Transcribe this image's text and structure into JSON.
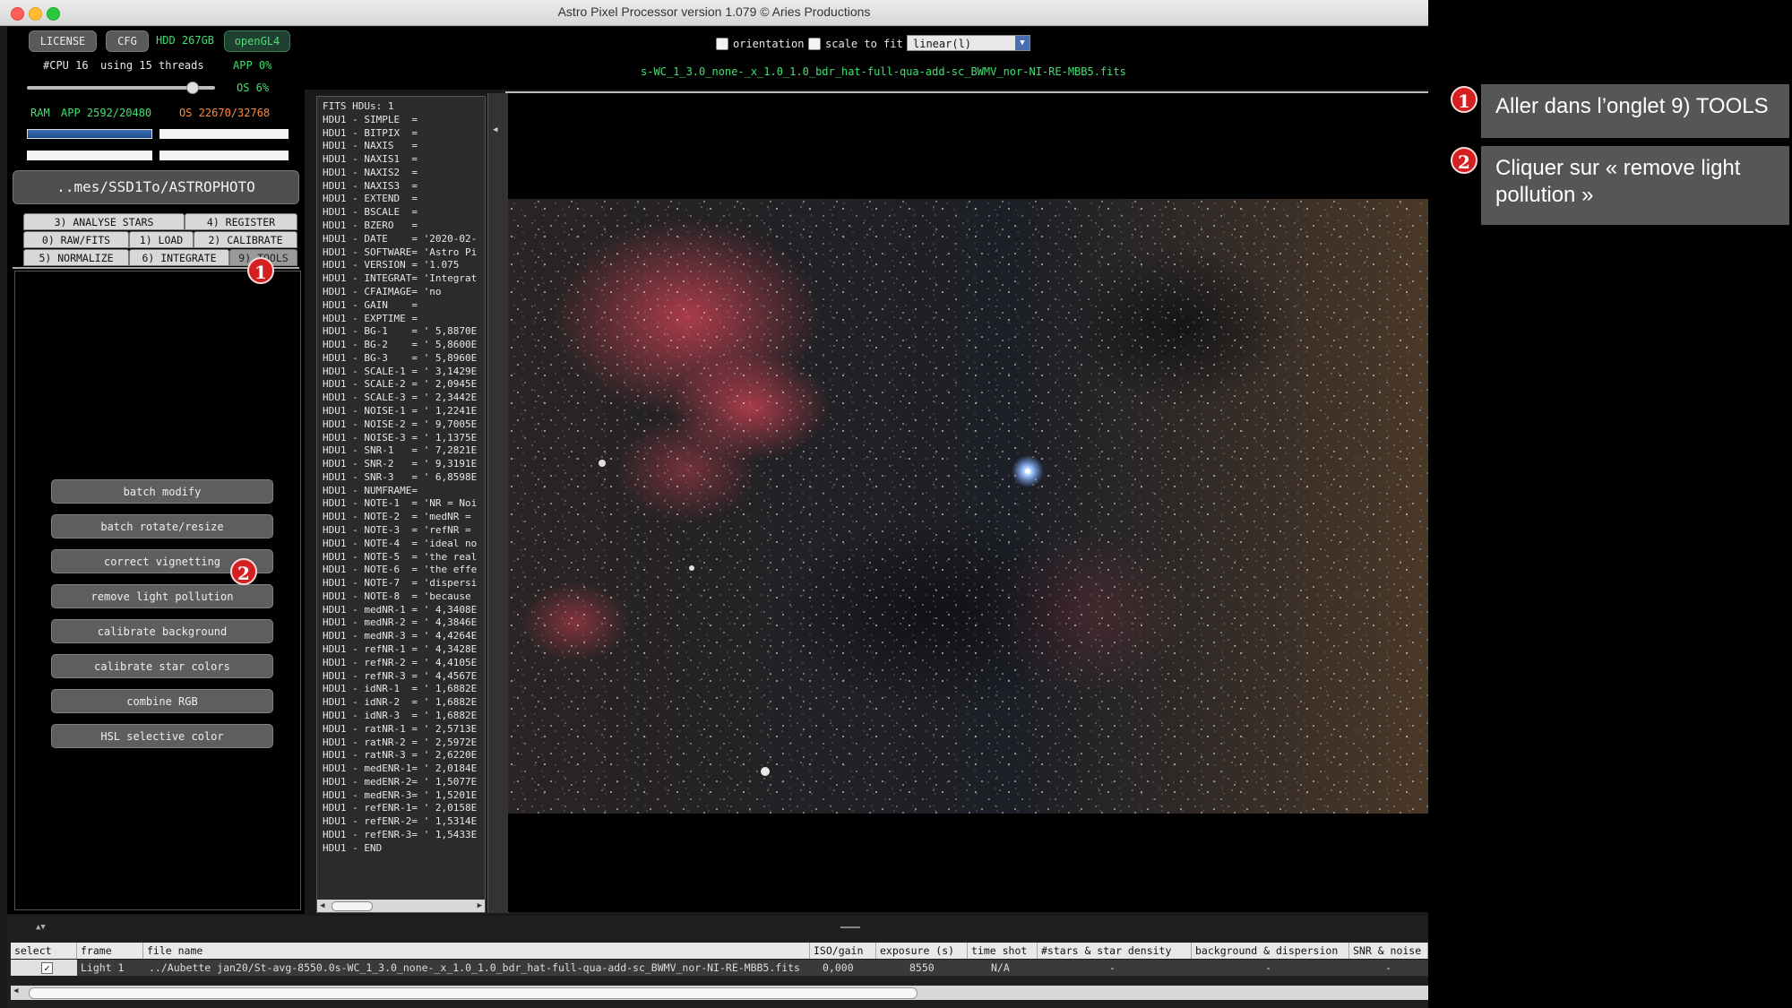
{
  "window": {
    "title": "Astro Pixel Processor version 1.079 © Aries Productions"
  },
  "top": {
    "license": "LICENSE",
    "cfg": "CFG",
    "hdd": "HDD 267GB",
    "opengl": "openGL4",
    "cpu": "#CPU 16",
    "threads": "using 15 threads",
    "app_cpu": "APP 0%",
    "os_cpu": "OS 6%",
    "ram_label": "RAM",
    "ram_app": "APP 2592/20480",
    "ram_os": "OS 22670/32768",
    "path": "..mes/SSD1To/ASTROPHOTO"
  },
  "tabs": {
    "row1": [
      "3) ANALYSE STARS",
      "4) REGISTER"
    ],
    "row2": [
      "0) RAW/FITS",
      "1) LOAD",
      "2) CALIBRATE"
    ],
    "row3": [
      "5) NORMALIZE",
      "6) INTEGRATE",
      "9) TOOLS"
    ]
  },
  "tools": [
    "batch modify",
    "batch rotate/resize",
    "correct vignetting",
    "remove light pollution",
    "calibrate background",
    "calibrate star colors",
    "combine RGB",
    "HSL selective color"
  ],
  "view": {
    "orientation_label": "orientation",
    "scale_label": "scale to fit",
    "stretch_value": "linear(l)",
    "filename": "s-WC_1_3.0_none-_x_1.0_1.0_bdr_hat-full-qua-add-sc_BWMV_nor-NI-RE-MBB5.fits"
  },
  "fits_header": [
    "FITS HDUs: 1",
    "HDU1 - SIMPLE  =",
    "HDU1 - BITPIX  =",
    "HDU1 - NAXIS   =",
    "HDU1 - NAXIS1  =",
    "HDU1 - NAXIS2  =",
    "HDU1 - NAXIS3  =",
    "HDU1 - EXTEND  =",
    "HDU1 - BSCALE  =",
    "HDU1 - BZERO   =",
    "HDU1 - DATE    = '2020-02-",
    "HDU1 - SOFTWARE= 'Astro Pi",
    "HDU1 - VERSION = '1.075",
    "HDU1 - INTEGRAT= 'Integrat",
    "HDU1 - CFAIMAGE= 'no",
    "HDU1 - GAIN    =",
    "HDU1 - EXPTIME =",
    "HDU1 - BG-1    = ' 5,8870E",
    "HDU1 - BG-2    = ' 5,8600E",
    "HDU1 - BG-3    = ' 5,8960E",
    "HDU1 - SCALE-1 = ' 3,1429E",
    "HDU1 - SCALE-2 = ' 2,0945E",
    "HDU1 - SCALE-3 = ' 2,3442E",
    "HDU1 - NOISE-1 = ' 1,2241E",
    "HDU1 - NOISE-2 = ' 9,7005E",
    "HDU1 - NOISE-3 = ' 1,1375E",
    "HDU1 - SNR-1   = ' 7,2821E",
    "HDU1 - SNR-2   = ' 9,3191E",
    "HDU1 - SNR-3   = ' 6,8598E",
    "HDU1 - NUMFRAME=",
    "HDU1 - NOTE-1  = 'NR = Noi",
    "HDU1 - NOTE-2  = 'medNR =",
    "HDU1 - NOTE-3  = 'refNR =",
    "HDU1 - NOTE-4  = 'ideal no",
    "HDU1 - NOTE-5  = 'the real",
    "HDU1 - NOTE-6  = 'the effe",
    "HDU1 - NOTE-7  = 'dispersi",
    "HDU1 - NOTE-8  = 'because",
    "HDU1 - medNR-1 = ' 4,3408E",
    "HDU1 - medNR-2 = ' 4,3846E",
    "HDU1 - medNR-3 = ' 4,4264E",
    "HDU1 - refNR-1 = ' 4,3428E",
    "HDU1 - refNR-2 = ' 4,4105E",
    "HDU1 - refNR-3 = ' 4,4567E",
    "HDU1 - idNR-1  = ' 1,6882E",
    "HDU1 - idNR-2  = ' 1,6882E",
    "HDU1 - idNR-3  = ' 1,6882E",
    "HDU1 - ratNR-1 = ' 2,5713E",
    "HDU1 - ratNR-2 = ' 2,5972E",
    "HDU1 - ratNR-3 = ' 2,6220E",
    "HDU1 - medENR-1= ' 2,0184E",
    "HDU1 - medENR-2= ' 1,5077E",
    "HDU1 - medENR-3= ' 1,5201E",
    "HDU1 - refENR-1= ' 2,0158E",
    "HDU1 - refENR-2= ' 1,5314E",
    "HDU1 - refENR-3= ' 1,5433E",
    "HDU1 - END"
  ],
  "table": {
    "headers": [
      "select",
      "frame",
      "file name",
      "ISO/gain",
      "exposure (s)",
      "time shot",
      "#stars & star density",
      "background & dispersion",
      "SNR & noise"
    ],
    "row": {
      "frame": "Light 1",
      "file": "../Aubette jan20/St-avg-8550.0s-WC_1_3.0_none-_x_1.0_1.0_bdr_hat-full-qua-add-sc_BWMV_nor-NI-RE-MBB5.fits",
      "iso": "0,000",
      "exposure": "8550",
      "time": "N/A",
      "stars": "-",
      "background": "-",
      "snr": "-"
    }
  },
  "annotations": {
    "badge1": "1",
    "badge2": "2",
    "step1": "Aller dans l’onglet 9) TOOLS",
    "step2": "Cliquer sur « remove light pollution »"
  }
}
